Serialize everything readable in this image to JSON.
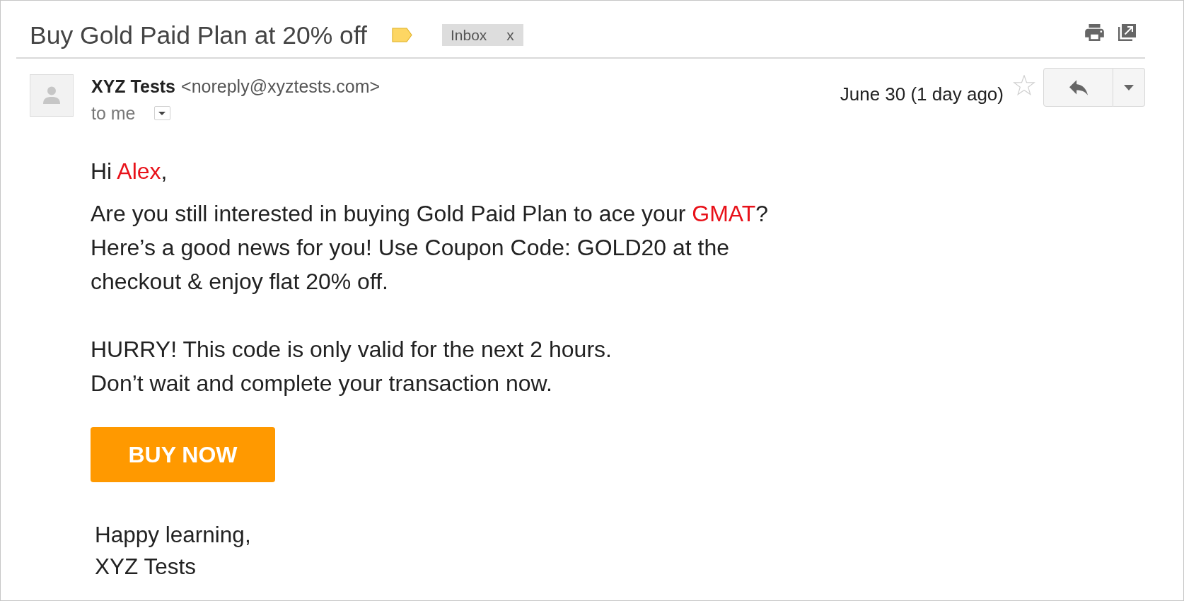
{
  "subject": {
    "title": "Buy Gold Paid Plan at 20% off",
    "important": true,
    "labels": [
      {
        "text": "Inbox",
        "remove": "x"
      }
    ]
  },
  "message": {
    "sender_name": "XYZ Tests",
    "sender_email": "<noreply@xyztests.com>",
    "recipient": "to me",
    "date": "June 30 (1 day ago)",
    "starred": false
  },
  "body": {
    "greeting": {
      "segments": [
        {
          "text": "Hi ",
          "highlight": false
        },
        {
          "text": "Alex",
          "highlight": true
        },
        {
          "text": ",",
          "highlight": false
        }
      ]
    },
    "paragraphs": [
      {
        "lines": [
          {
            "segments": [
              {
                "text": "Are you still interested in buying Gold Paid Plan to ace your ",
                "highlight": false
              },
              {
                "text": "GMAT",
                "highlight": true
              },
              {
                "text": "?",
                "highlight": false
              }
            ]
          },
          {
            "segments": [
              {
                "text": "Here’s a good news for you! Use Coupon Code: GOLD20 at the checkout & enjoy flat 20% off.",
                "highlight": false
              }
            ]
          }
        ]
      },
      {
        "lines": [
          {
            "segments": [
              {
                "text": "HURRY! This code is only valid for the next 2 hours.",
                "highlight": false
              }
            ]
          },
          {
            "segments": [
              {
                "text": "Don’t wait and complete your transaction now.",
                "highlight": false
              }
            ]
          }
        ]
      }
    ],
    "button": "BUY NOW",
    "signature": [
      "Happy learning,",
      "XYZ Tests"
    ]
  }
}
